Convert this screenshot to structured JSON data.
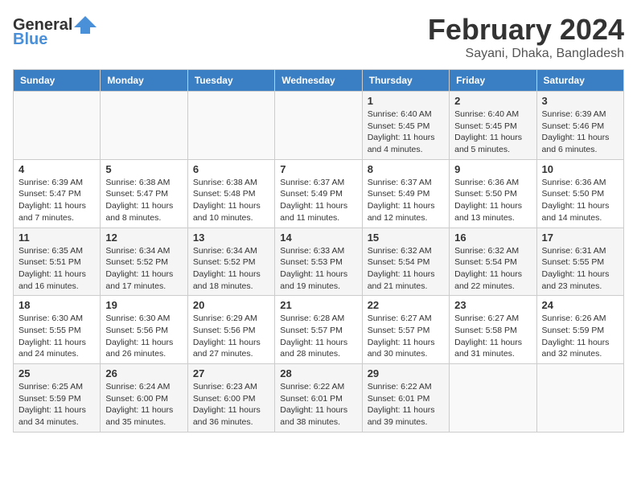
{
  "header": {
    "logo_line1": "General",
    "logo_line2": "Blue",
    "month": "February 2024",
    "location": "Sayani, Dhaka, Bangladesh"
  },
  "weekdays": [
    "Sunday",
    "Monday",
    "Tuesday",
    "Wednesday",
    "Thursday",
    "Friday",
    "Saturday"
  ],
  "weeks": [
    [
      {
        "day": "",
        "info": ""
      },
      {
        "day": "",
        "info": ""
      },
      {
        "day": "",
        "info": ""
      },
      {
        "day": "",
        "info": ""
      },
      {
        "day": "1",
        "info": "Sunrise: 6:40 AM\nSunset: 5:45 PM\nDaylight: 11 hours\nand 4 minutes."
      },
      {
        "day": "2",
        "info": "Sunrise: 6:40 AM\nSunset: 5:45 PM\nDaylight: 11 hours\nand 5 minutes."
      },
      {
        "day": "3",
        "info": "Sunrise: 6:39 AM\nSunset: 5:46 PM\nDaylight: 11 hours\nand 6 minutes."
      }
    ],
    [
      {
        "day": "4",
        "info": "Sunrise: 6:39 AM\nSunset: 5:47 PM\nDaylight: 11 hours\nand 7 minutes."
      },
      {
        "day": "5",
        "info": "Sunrise: 6:38 AM\nSunset: 5:47 PM\nDaylight: 11 hours\nand 8 minutes."
      },
      {
        "day": "6",
        "info": "Sunrise: 6:38 AM\nSunset: 5:48 PM\nDaylight: 11 hours\nand 10 minutes."
      },
      {
        "day": "7",
        "info": "Sunrise: 6:37 AM\nSunset: 5:49 PM\nDaylight: 11 hours\nand 11 minutes."
      },
      {
        "day": "8",
        "info": "Sunrise: 6:37 AM\nSunset: 5:49 PM\nDaylight: 11 hours\nand 12 minutes."
      },
      {
        "day": "9",
        "info": "Sunrise: 6:36 AM\nSunset: 5:50 PM\nDaylight: 11 hours\nand 13 minutes."
      },
      {
        "day": "10",
        "info": "Sunrise: 6:36 AM\nSunset: 5:50 PM\nDaylight: 11 hours\nand 14 minutes."
      }
    ],
    [
      {
        "day": "11",
        "info": "Sunrise: 6:35 AM\nSunset: 5:51 PM\nDaylight: 11 hours\nand 16 minutes."
      },
      {
        "day": "12",
        "info": "Sunrise: 6:34 AM\nSunset: 5:52 PM\nDaylight: 11 hours\nand 17 minutes."
      },
      {
        "day": "13",
        "info": "Sunrise: 6:34 AM\nSunset: 5:52 PM\nDaylight: 11 hours\nand 18 minutes."
      },
      {
        "day": "14",
        "info": "Sunrise: 6:33 AM\nSunset: 5:53 PM\nDaylight: 11 hours\nand 19 minutes."
      },
      {
        "day": "15",
        "info": "Sunrise: 6:32 AM\nSunset: 5:54 PM\nDaylight: 11 hours\nand 21 minutes."
      },
      {
        "day": "16",
        "info": "Sunrise: 6:32 AM\nSunset: 5:54 PM\nDaylight: 11 hours\nand 22 minutes."
      },
      {
        "day": "17",
        "info": "Sunrise: 6:31 AM\nSunset: 5:55 PM\nDaylight: 11 hours\nand 23 minutes."
      }
    ],
    [
      {
        "day": "18",
        "info": "Sunrise: 6:30 AM\nSunset: 5:55 PM\nDaylight: 11 hours\nand 24 minutes."
      },
      {
        "day": "19",
        "info": "Sunrise: 6:30 AM\nSunset: 5:56 PM\nDaylight: 11 hours\nand 26 minutes."
      },
      {
        "day": "20",
        "info": "Sunrise: 6:29 AM\nSunset: 5:56 PM\nDaylight: 11 hours\nand 27 minutes."
      },
      {
        "day": "21",
        "info": "Sunrise: 6:28 AM\nSunset: 5:57 PM\nDaylight: 11 hours\nand 28 minutes."
      },
      {
        "day": "22",
        "info": "Sunrise: 6:27 AM\nSunset: 5:57 PM\nDaylight: 11 hours\nand 30 minutes."
      },
      {
        "day": "23",
        "info": "Sunrise: 6:27 AM\nSunset: 5:58 PM\nDaylight: 11 hours\nand 31 minutes."
      },
      {
        "day": "24",
        "info": "Sunrise: 6:26 AM\nSunset: 5:59 PM\nDaylight: 11 hours\nand 32 minutes."
      }
    ],
    [
      {
        "day": "25",
        "info": "Sunrise: 6:25 AM\nSunset: 5:59 PM\nDaylight: 11 hours\nand 34 minutes."
      },
      {
        "day": "26",
        "info": "Sunrise: 6:24 AM\nSunset: 6:00 PM\nDaylight: 11 hours\nand 35 minutes."
      },
      {
        "day": "27",
        "info": "Sunrise: 6:23 AM\nSunset: 6:00 PM\nDaylight: 11 hours\nand 36 minutes."
      },
      {
        "day": "28",
        "info": "Sunrise: 6:22 AM\nSunset: 6:01 PM\nDaylight: 11 hours\nand 38 minutes."
      },
      {
        "day": "29",
        "info": "Sunrise: 6:22 AM\nSunset: 6:01 PM\nDaylight: 11 hours\nand 39 minutes."
      },
      {
        "day": "",
        "info": ""
      },
      {
        "day": "",
        "info": ""
      }
    ]
  ]
}
